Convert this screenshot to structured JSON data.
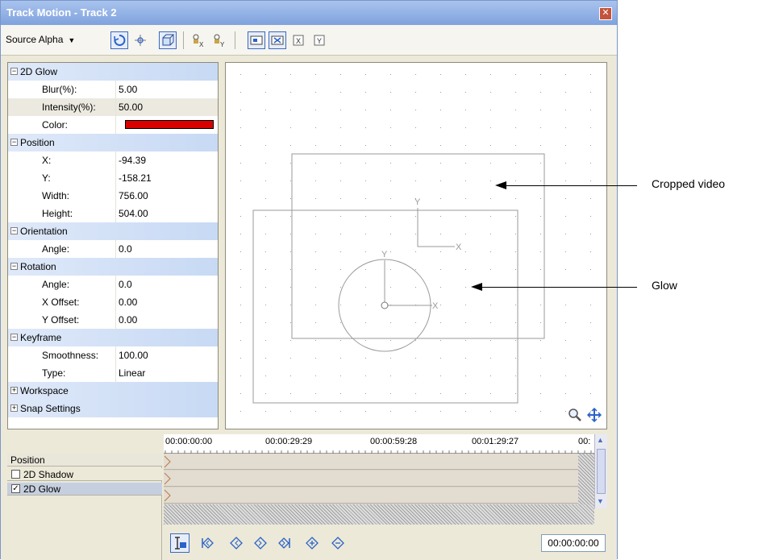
{
  "window": {
    "title": "Track Motion - Track 2",
    "close_glyph": "✕"
  },
  "toolbar": {
    "source_label": "Source Alpha",
    "dropdown_glyph": "▼",
    "icons": [
      "rotate-icon",
      "snap-icon",
      "3d-box-icon",
      "lock-x-icon",
      "lock-y-icon",
      "edit-in-object-space-icon",
      "prevent-movement-icon",
      "prevent-x-icon",
      "prevent-y-icon"
    ]
  },
  "properties": {
    "groups": [
      {
        "name": "2D Glow",
        "expanded": true,
        "toggle": "−",
        "items": [
          {
            "label": "Blur(%):",
            "value": "5.00"
          },
          {
            "label": "Intensity(%):",
            "value": "50.00",
            "selected": true
          },
          {
            "label": "Color:",
            "value": "",
            "color": "#d90000"
          }
        ]
      },
      {
        "name": "Position",
        "expanded": true,
        "toggle": "−",
        "items": [
          {
            "label": "X:",
            "value": "-94.39"
          },
          {
            "label": "Y:",
            "value": "-158.21"
          },
          {
            "label": "Width:",
            "value": "756.00"
          },
          {
            "label": "Height:",
            "value": "504.00"
          }
        ]
      },
      {
        "name": "Orientation",
        "expanded": true,
        "toggle": "−",
        "items": [
          {
            "label": "Angle:",
            "value": "0.0"
          }
        ]
      },
      {
        "name": "Rotation",
        "expanded": true,
        "toggle": "−",
        "items": [
          {
            "label": "Angle:",
            "value": "0.0"
          },
          {
            "label": "X Offset:",
            "value": "0.00"
          },
          {
            "label": "Y Offset:",
            "value": "0.00"
          }
        ]
      },
      {
        "name": "Keyframe",
        "expanded": true,
        "toggle": "−",
        "items": [
          {
            "label": "Smoothness:",
            "value": "100.00"
          },
          {
            "label": "Type:",
            "value": "Linear"
          }
        ]
      },
      {
        "name": "Workspace",
        "expanded": false,
        "toggle": "+",
        "items": []
      },
      {
        "name": "Snap Settings",
        "expanded": false,
        "toggle": "+",
        "items": []
      }
    ]
  },
  "canvas": {
    "axis_y": "Y",
    "axis_x": "X",
    "zoom_icon": "magnifier-icon",
    "move_icon": "move-arrows-icon"
  },
  "timeline": {
    "tracks": [
      {
        "label": "Position",
        "checkbox": false
      },
      {
        "label": "2D Shadow",
        "checkbox": true,
        "checked": false
      },
      {
        "label": "2D Glow",
        "checkbox": true,
        "checked": true,
        "selected": true
      }
    ],
    "ruler": [
      "00:00:00:00",
      "00:00:29:29",
      "00:00:59:28",
      "00:01:29:27",
      "00:"
    ],
    "timecode": "00:00:00:00",
    "check_glyph": "✓"
  },
  "callouts": [
    {
      "label": "Cropped video"
    },
    {
      "label": "Glow"
    }
  ]
}
